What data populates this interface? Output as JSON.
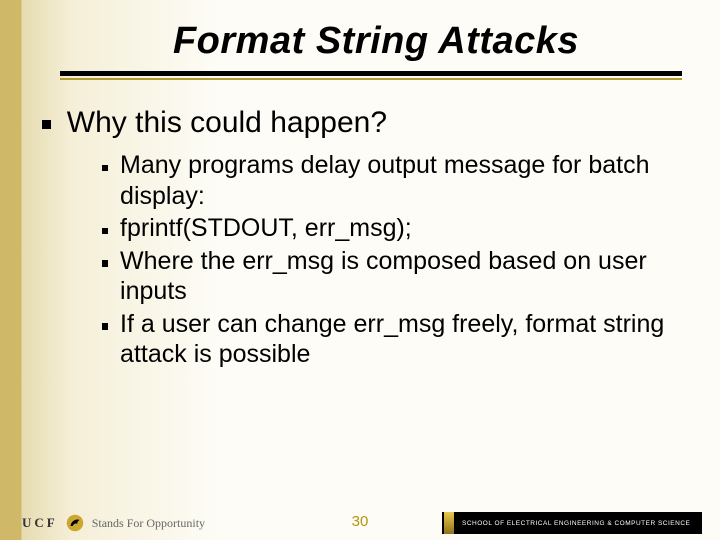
{
  "title": "Format String Attacks",
  "heading": "Why this could happen?",
  "bullets": [
    "Many programs delay output message for batch display:",
    "fprintf(STDOUT, err_msg);",
    "Where the err_msg is composed based on user inputs",
    "If a user can change err_msg freely, format string attack is possible"
  ],
  "footer": {
    "ucf": "UCF",
    "tagline": "Stands For Opportunity",
    "page": "30",
    "school": "SCHOOL OF ELECTRICAL ENGINEERING & COMPUTER SCIENCE"
  }
}
